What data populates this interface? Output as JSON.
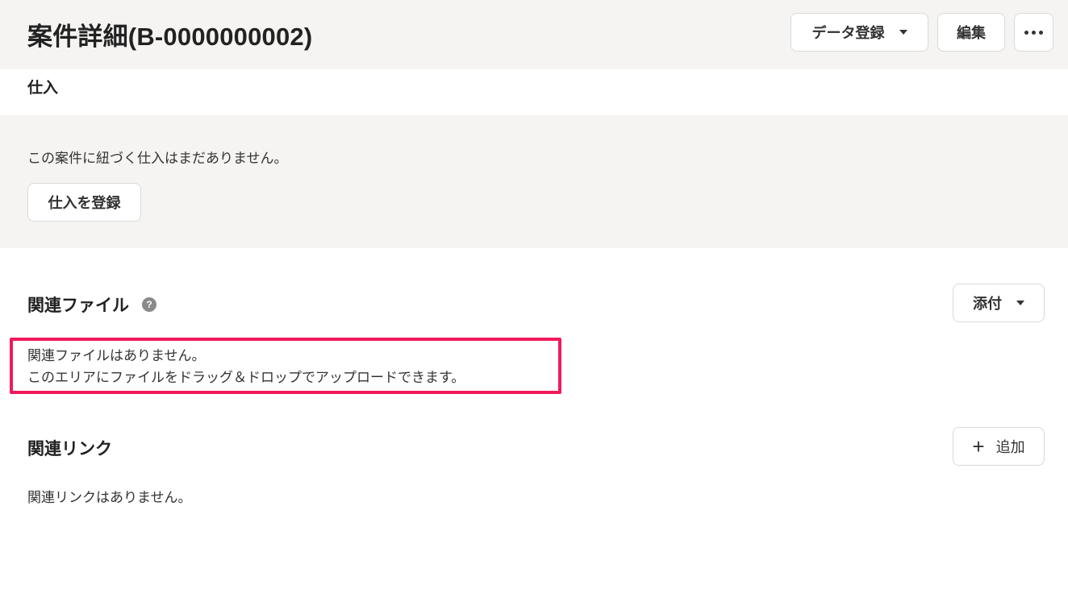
{
  "header": {
    "title": "案件詳細(B-0000000002)",
    "data_register_label": "データ登録",
    "edit_label": "編集",
    "more_icon": "more-icon"
  },
  "purchase": {
    "title": "仕入",
    "empty_text": "この案件に紐づく仕入はまだありません。",
    "register_button_label": "仕入を登録"
  },
  "related_files": {
    "title": "関連ファイル",
    "help_icon": "?",
    "attach_button_label": "添付",
    "empty_line_1": "関連ファイルはありません。",
    "empty_line_2": "このエリアにファイルをドラッグ＆ドロップでアップロードできます。",
    "highlight_color": "#f21a5b"
  },
  "related_links": {
    "title": "関連リンク",
    "add_button_label": "追加",
    "add_button_icon": "+",
    "empty_text": "関連リンクはありません。"
  },
  "colors": {
    "panel_bg": "#f5f4f2",
    "text": "#222222"
  }
}
